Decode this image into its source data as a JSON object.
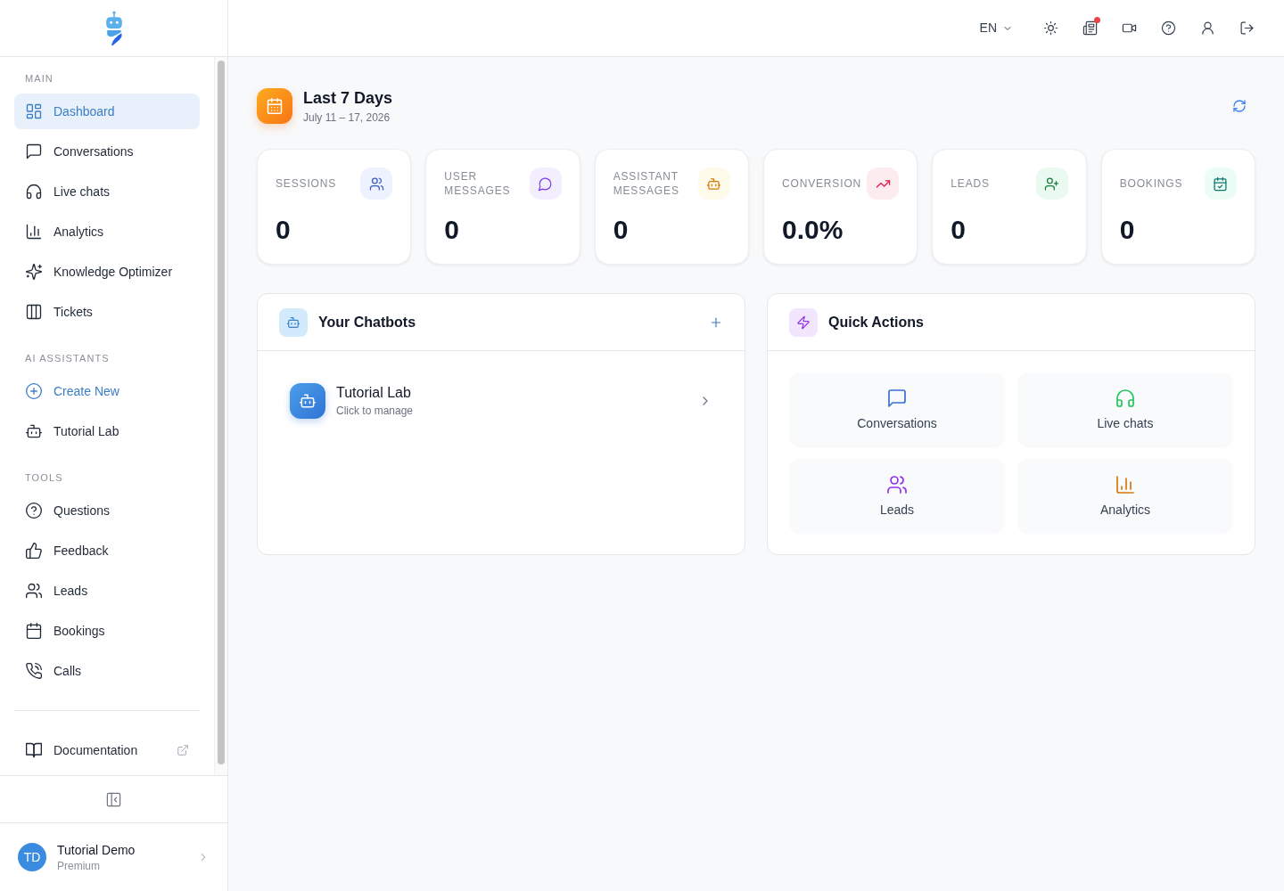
{
  "sidebar": {
    "sections": [
      {
        "heading": "MAIN",
        "items": [
          {
            "label": "Dashboard",
            "kind": "nav",
            "selected": true
          },
          {
            "label": "Conversations",
            "kind": "nav",
            "selected": false
          },
          {
            "label": "Live chats",
            "kind": "nav",
            "selected": false
          },
          {
            "label": "Analytics",
            "kind": "nav",
            "selected": false
          },
          {
            "label": "Knowledge Optimizer",
            "kind": "nav",
            "selected": false
          },
          {
            "label": "Tickets",
            "kind": "nav",
            "selected": false
          }
        ]
      },
      {
        "heading": "AI ASSISTANTS",
        "items": [
          {
            "label": "Create New",
            "kind": "create",
            "selected": false
          },
          {
            "label": "Tutorial Lab",
            "kind": "nav",
            "selected": false
          }
        ]
      },
      {
        "heading": "TOOLS",
        "items": [
          {
            "label": "Questions",
            "kind": "nav",
            "selected": false
          },
          {
            "label": "Feedback",
            "kind": "nav",
            "selected": false
          },
          {
            "label": "Leads",
            "kind": "nav",
            "selected": false
          },
          {
            "label": "Bookings",
            "kind": "nav",
            "selected": false
          },
          {
            "label": "Calls",
            "kind": "nav",
            "selected": false
          }
        ]
      }
    ],
    "footer_links": [
      {
        "label": "Documentation",
        "external": true
      }
    ],
    "user": {
      "initials": "TD",
      "name": "Tutorial Demo",
      "plan": "Premium"
    }
  },
  "topbar": {
    "language": "EN",
    "news_unread": true
  },
  "period": {
    "title": "Last 7 Days",
    "range": "July 11 – 17, 2026"
  },
  "stats": [
    {
      "label": "SESSIONS",
      "value": "0"
    },
    {
      "label": "USER MESSAGES",
      "value": "0"
    },
    {
      "label": "ASSISTANT MESSAGES",
      "value": "0"
    },
    {
      "label": "CONVERSION",
      "value": "0.0%"
    },
    {
      "label": "LEADS",
      "value": "0"
    },
    {
      "label": "BOOKINGS",
      "value": "0"
    }
  ],
  "chatbots": {
    "title": "Your Chatbots",
    "items": [
      {
        "name": "Tutorial Lab",
        "hint": "Click to manage"
      }
    ]
  },
  "quick_actions": {
    "title": "Quick Actions",
    "items": [
      {
        "label": "Conversations"
      },
      {
        "label": "Live chats"
      },
      {
        "label": "Leads"
      },
      {
        "label": "Analytics"
      }
    ]
  }
}
